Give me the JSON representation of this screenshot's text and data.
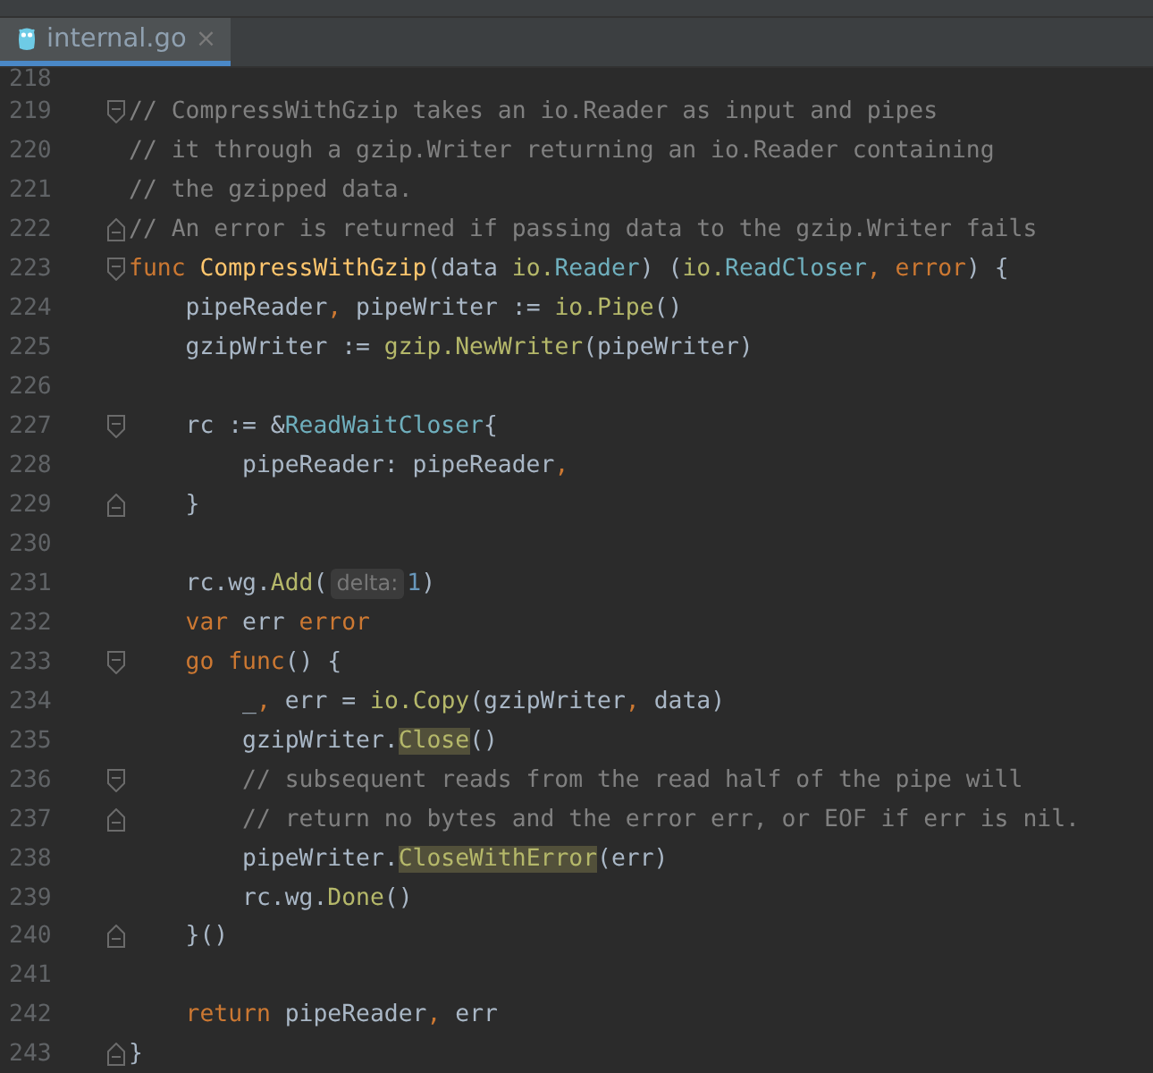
{
  "tabs": [
    {
      "label": "internal.go",
      "selected": true,
      "close": "×"
    }
  ],
  "lines": [
    {
      "number": "218",
      "fold_open": false,
      "fold_close": false
    },
    {
      "number": "219",
      "fold_open": true,
      "fold_close": false,
      "tokens": [
        {
          "kind": "comment",
          "text": "// CompressWithGzip takes an io.Reader as input and pipes"
        }
      ]
    },
    {
      "number": "220",
      "fold_open": false,
      "fold_close": false,
      "tokens": [
        {
          "kind": "comment",
          "text": "// it through a gzip.Writer returning an io.Reader containing"
        }
      ]
    },
    {
      "number": "221",
      "fold_open": false,
      "fold_close": false,
      "tokens": [
        {
          "kind": "comment",
          "text": "// the gzipped data."
        }
      ]
    },
    {
      "number": "222",
      "fold_open": false,
      "fold_close": true,
      "tokens": [
        {
          "kind": "comment",
          "text": "// An error is returned if passing data to the gzip.Writer fails"
        }
      ]
    },
    {
      "number": "223",
      "fold_open": true,
      "fold_close": false,
      "tokens": [
        {
          "kind": "keyword",
          "text": "func "
        },
        {
          "kind": "decl",
          "text": "CompressWithGzip"
        },
        {
          "kind": "plain",
          "text": "(data "
        },
        {
          "kind": "pkg",
          "text": "io."
        },
        {
          "kind": "type",
          "text": "Reader"
        },
        {
          "kind": "plain",
          "text": ") ("
        },
        {
          "kind": "pkg",
          "text": "io."
        },
        {
          "kind": "type",
          "text": "ReadCloser"
        },
        {
          "kind": "keyword",
          "text": ", error"
        },
        {
          "kind": "plain",
          "text": ") {"
        }
      ]
    },
    {
      "number": "224",
      "fold_open": false,
      "fold_close": false,
      "tokens": [
        {
          "kind": "plain",
          "text": "    pipeReader"
        },
        {
          "kind": "keyword",
          "text": ", "
        },
        {
          "kind": "plain",
          "text": "pipeWriter := "
        },
        {
          "kind": "call",
          "text": "io.Pipe"
        },
        {
          "kind": "plain",
          "text": "()"
        }
      ]
    },
    {
      "number": "225",
      "fold_open": false,
      "fold_close": false,
      "tokens": [
        {
          "kind": "plain",
          "text": "    gzipWriter := "
        },
        {
          "kind": "call",
          "text": "gzip.NewWriter"
        },
        {
          "kind": "plain",
          "text": "(pipeWriter)"
        }
      ]
    },
    {
      "number": "226",
      "fold_open": false,
      "fold_close": false
    },
    {
      "number": "227",
      "fold_open": true,
      "fold_close": false,
      "tokens": [
        {
          "kind": "plain",
          "text": "    rc := &"
        },
        {
          "kind": "type",
          "text": "ReadWaitCloser"
        },
        {
          "kind": "plain",
          "text": "{"
        }
      ]
    },
    {
      "number": "228",
      "fold_open": false,
      "fold_close": false,
      "tokens": [
        {
          "kind": "plain",
          "text": "        pipeReader: pipeReader"
        },
        {
          "kind": "keyword",
          "text": ","
        }
      ]
    },
    {
      "number": "229",
      "fold_open": false,
      "fold_close": true,
      "tokens": [
        {
          "kind": "plain",
          "text": "    }"
        }
      ]
    },
    {
      "number": "230",
      "fold_open": false,
      "fold_close": false
    },
    {
      "number": "231",
      "fold_open": false,
      "fold_close": false,
      "tokens": [
        {
          "kind": "plain",
          "text": "    rc.wg."
        },
        {
          "kind": "call",
          "text": "Add"
        },
        {
          "kind": "plain",
          "text": "("
        },
        {
          "kind": "hint",
          "text": "delta:"
        },
        {
          "kind": "number",
          "text": "1"
        },
        {
          "kind": "plain",
          "text": ")"
        }
      ]
    },
    {
      "number": "232",
      "fold_open": false,
      "fold_close": false,
      "tokens": [
        {
          "kind": "keyword",
          "text": "    var "
        },
        {
          "kind": "plain",
          "text": "err "
        },
        {
          "kind": "keyword",
          "text": "error"
        }
      ]
    },
    {
      "number": "233",
      "fold_open": true,
      "fold_close": false,
      "tokens": [
        {
          "kind": "keyword",
          "text": "    go func"
        },
        {
          "kind": "plain",
          "text": "() {"
        }
      ]
    },
    {
      "number": "234",
      "fold_open": false,
      "fold_close": false,
      "tokens": [
        {
          "kind": "plain",
          "text": "        _"
        },
        {
          "kind": "keyword",
          "text": ", "
        },
        {
          "kind": "plain",
          "text": "err = "
        },
        {
          "kind": "call",
          "text": "io.Copy"
        },
        {
          "kind": "plain",
          "text": "(gzipWriter"
        },
        {
          "kind": "keyword",
          "text": ", "
        },
        {
          "kind": "plain",
          "text": "data)"
        }
      ]
    },
    {
      "number": "235",
      "fold_open": false,
      "fold_close": false,
      "tokens": [
        {
          "kind": "plain",
          "text": "        gzipWriter."
        },
        {
          "kind": "match",
          "text": "Close"
        },
        {
          "kind": "plain",
          "text": "()"
        }
      ]
    },
    {
      "number": "236",
      "fold_open": true,
      "fold_close": false,
      "tokens": [
        {
          "kind": "comment",
          "text": "        // subsequent reads from the read half of the pipe will"
        }
      ]
    },
    {
      "number": "237",
      "fold_open": false,
      "fold_close": true,
      "tokens": [
        {
          "kind": "comment",
          "text": "        // return no bytes and the error err, or EOF if err is nil."
        }
      ]
    },
    {
      "number": "238",
      "fold_open": false,
      "fold_close": false,
      "tokens": [
        {
          "kind": "plain",
          "text": "        pipeWriter."
        },
        {
          "kind": "match",
          "text": "CloseWithError"
        },
        {
          "kind": "plain",
          "text": "(err)"
        }
      ]
    },
    {
      "number": "239",
      "fold_open": false,
      "fold_close": false,
      "tokens": [
        {
          "kind": "plain",
          "text": "        rc.wg."
        },
        {
          "kind": "call",
          "text": "Done"
        },
        {
          "kind": "plain",
          "text": "()"
        }
      ]
    },
    {
      "number": "240",
      "fold_open": false,
      "fold_close": true,
      "tokens": [
        {
          "kind": "plain",
          "text": "    }()"
        }
      ]
    },
    {
      "number": "241",
      "fold_open": false,
      "fold_close": false
    },
    {
      "number": "242",
      "fold_open": false,
      "fold_close": false,
      "tokens": [
        {
          "kind": "keyword",
          "text": "    return "
        },
        {
          "kind": "plain",
          "text": "pipeReader"
        },
        {
          "kind": "keyword",
          "text": ", "
        },
        {
          "kind": "plain",
          "text": "err"
        }
      ]
    },
    {
      "number": "243",
      "fold_open": false,
      "fold_close": true,
      "tokens": [
        {
          "kind": "plain",
          "text": "}"
        }
      ]
    }
  ]
}
